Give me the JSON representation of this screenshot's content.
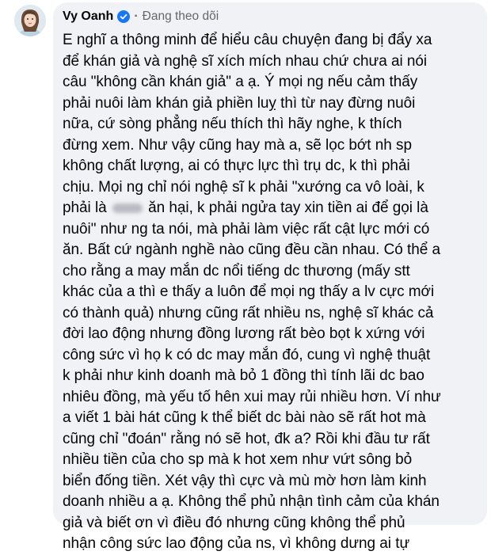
{
  "comment": {
    "author": "Vy Oanh",
    "separator": "·",
    "follow_status": "Đang theo dõi",
    "lines": [
      "E nghĩ a thông minh để hiểu câu chuyện đang bị đẩy xa",
      "để khán giả và nghệ sĩ xích mích nhau chứ chưa ai nói",
      "câu \"không cần khán giả\" a ạ. Ý mọi ng nếu cảm thấy",
      "phải nuôi làm khán giả phiền luỵ thì từ nay đừng nuôi",
      "nữa, cứ sòng phẳng nếu thích thì hãy nghe, k thích",
      "đừng xem. Như vậy cũng hay mà a, sẽ lọc bớt nh sp",
      "không chất lượng, ai có thực lực thì trụ dc, k thì phải",
      "chịu. Mọi ng chỉ nói nghệ sĩ k phải \"xướng ca vô loài, k",
      "",
      "nuôi\" như ng ta nói, mà phải làm việc rất cật lực mới có",
      "ăn. Bất cứ ngành nghề nào cũng đều cần nhau. Có thể a",
      "cho rằng a may mắn dc nổi tiếng dc thương (mấy stt",
      "khác của a thì e thấy a luôn để mọi ng thấy a lv cực mới",
      "có thành quả) nhưng cũng rất nhiều ns, nghệ sĩ khác cả",
      "đời lao động nhưng đồng lương rất bèo bọt k xứng với",
      "công sức vì họ k có dc may mắn đó, cung vì nghệ thuật",
      "k phải như kinh doanh mà bỏ 1 đồng thì tính lãi dc bao",
      "nhiêu đồng, mà yếu tố hên xui may rủi nhiều hơn. Ví như",
      "a viết 1 bài hát cũng k thể biết dc bài nào sẽ rất hot mà",
      "cũng chỉ \"đoán\" rằng nó sẽ hot, đk a? Rồi khi đầu tư rất",
      "nhiều tiền của cho sp mà k hot xem như vứt sông bỏ",
      "biển đống tiền. Xét vậy thì cực và mù mờ hơn làm kinh",
      "doanh nhiều a ạ. Không thể phủ nhận tình cảm của khán",
      "giả và biết ơn vì điều đó nhưng cũng không thể phủ",
      "nhận công sức lao động của ns, vì không dưng ai tự"
    ],
    "line9_before": "phải là",
    "line9_after": "ăn hại, k phải ngửa tay xin tiền ai để gọi là"
  },
  "colors": {
    "bubble_bg": "#f0f2f5",
    "text": "#050505",
    "muted": "#65676b",
    "verified": "#1877f2"
  }
}
